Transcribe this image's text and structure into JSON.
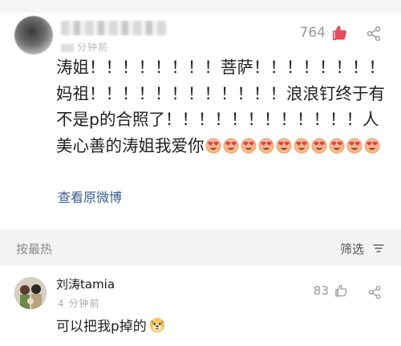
{
  "post": {
    "author": "",
    "time_suffix": "分钟前",
    "like_count": "764",
    "text_lines": [
      "涛姐！！！！！！！！菩萨！！！！！！！！",
      "妈祖！！！！！！！！！！！！浪浪钉终于有",
      "不是p的合照了！！！！！！！！！！！！人",
      "美心善的涛姐我爱你"
    ],
    "emoji_count": 10,
    "view_original": "查看原微博"
  },
  "comments_bar": {
    "sort_label": "按最热",
    "filter_label": "筛选"
  },
  "comment": {
    "author": "刘涛tamia",
    "time": "4 分钟前",
    "like_count": "83",
    "text": "可以把我p掉的"
  },
  "icons": {
    "like": "thumbs-up-icon",
    "share": "share-icon",
    "filter": "filter-icon",
    "heart_eyes": "heart-eyes-emoji",
    "doge": "doge-emoji"
  },
  "colors": {
    "link": "#3b5d89",
    "like_active": "#e84c5a",
    "muted": "#9a9a9a",
    "band": "#f4f4f4"
  }
}
